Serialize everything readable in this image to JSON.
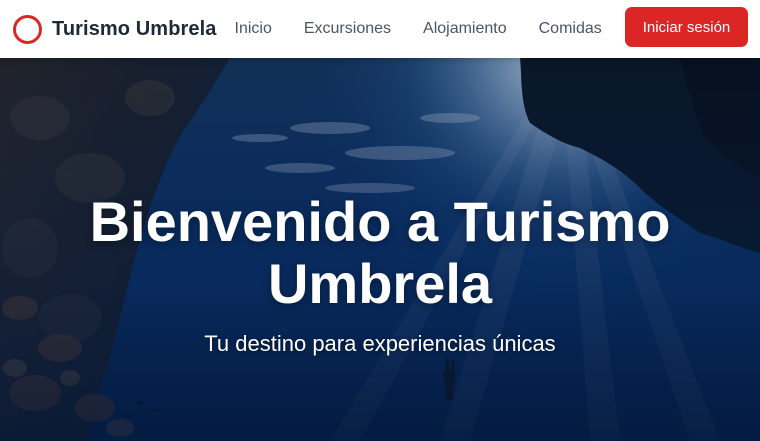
{
  "brand": {
    "name": "Turismo Umbrela",
    "logo_color": "#dc2626"
  },
  "nav": {
    "links": [
      {
        "label": "Inicio"
      },
      {
        "label": "Excursiones"
      },
      {
        "label": "Alojamiento"
      },
      {
        "label": "Comidas"
      }
    ],
    "login_label": "Iniciar sesión",
    "accent_color": "#dc2626"
  },
  "hero": {
    "title": "Bienvenido a Turismo Umbrela",
    "subtitle": "Tu destino para experiencias únicas",
    "background": "underwater-diver-photo"
  }
}
